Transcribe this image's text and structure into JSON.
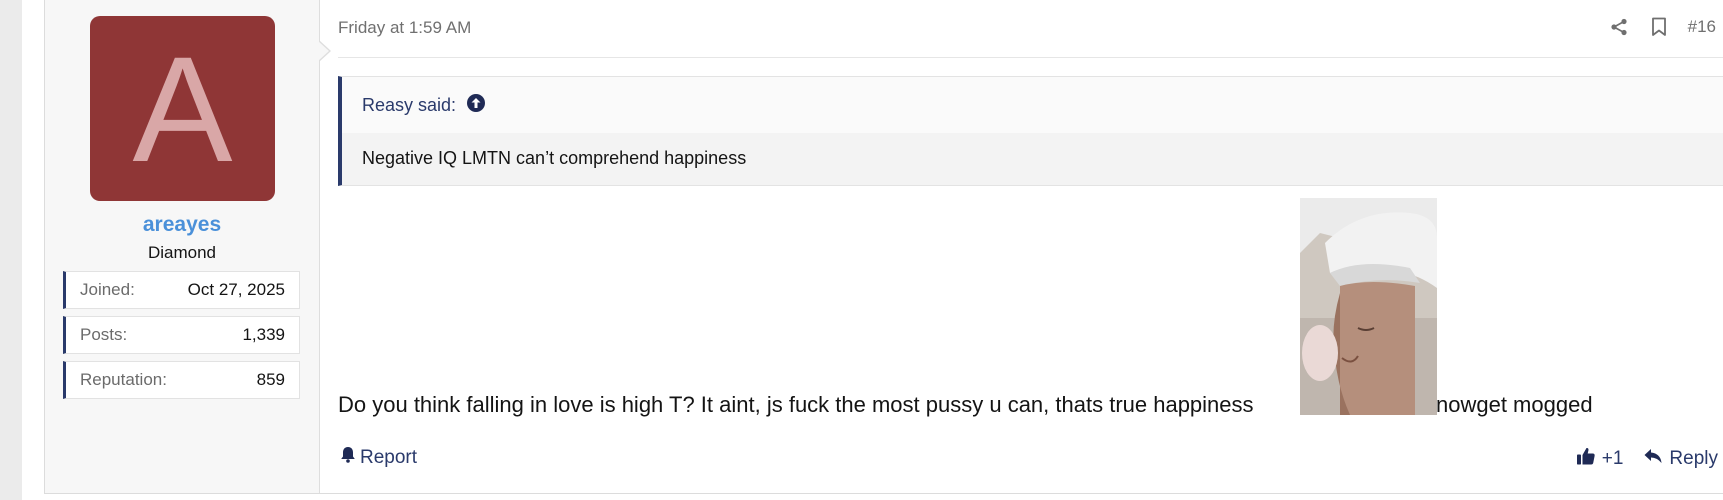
{
  "user": {
    "avatar_letter": "A",
    "avatar_color": "#8f3636",
    "name": "areayes",
    "title": "Diamond",
    "stats": [
      {
        "label": "Joined:",
        "value": "Oct 27, 2025"
      },
      {
        "label": "Posts:",
        "value": "1,339"
      },
      {
        "label": "Reputation:",
        "value": "859"
      }
    ]
  },
  "post": {
    "date": "Friday at 1:59 AM",
    "number": "#16",
    "quote": {
      "author": "Reasy said:",
      "text": "Negative IQ LMTN can’t comprehend happiness"
    },
    "message_before": "Do you think falling in love is high T? It aint, js fuck the most pussy u can, thats true happiness",
    "message_after": "nowget mogged",
    "actions": {
      "report": "Report",
      "like_count": "+1",
      "reply": "Reply"
    }
  },
  "icons": [
    "share-icon",
    "bookmark-icon",
    "arrow-up-circle-icon",
    "bell-icon",
    "thumbs-up-icon",
    "reply-arrow-icon"
  ],
  "colors": {
    "accent": "#2a3a6b",
    "username": "#4a90d9"
  }
}
